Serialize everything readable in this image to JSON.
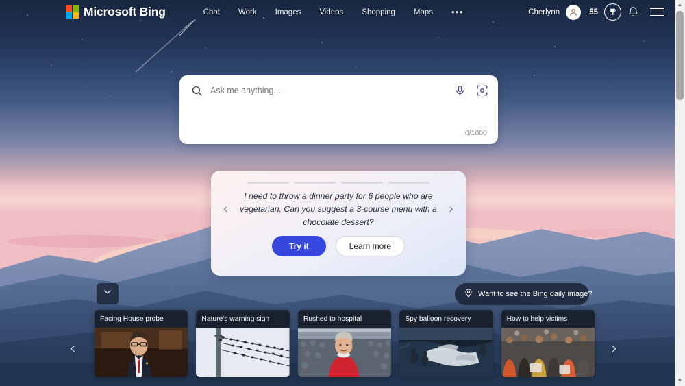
{
  "header": {
    "brand": "Microsoft Bing",
    "logo_icon": "microsoft-logo-icon",
    "logo_colors": [
      "#f25022",
      "#7fba00",
      "#00a4ef",
      "#ffb900"
    ],
    "nav": [
      {
        "label": "Chat",
        "name": "nav-chat"
      },
      {
        "label": "Work",
        "name": "nav-work"
      },
      {
        "label": "Images",
        "name": "nav-images"
      },
      {
        "label": "Videos",
        "name": "nav-videos"
      },
      {
        "label": "Shopping",
        "name": "nav-shopping"
      },
      {
        "label": "Maps",
        "name": "nav-maps"
      }
    ],
    "more_label": "•••",
    "username": "Cherlynn",
    "avatar_icon": "user-avatar-icon",
    "points": "55",
    "rewards_icon": "trophy-icon",
    "notifications_icon": "bell-icon",
    "menu_icon": "hamburger-menu-icon"
  },
  "search": {
    "placeholder": "Ask me anything...",
    "value": "",
    "search_icon": "search-icon",
    "mic_icon": "microphone-icon",
    "visual_search_icon": "visual-search-icon",
    "char_counter": "0/1000"
  },
  "suggestion": {
    "progress": [
      85,
      0,
      0,
      0
    ],
    "prompt": "I need to throw a dinner party for 6 people who are vegetarian. Can you suggest a 3-course menu with a chocolate dessert?",
    "try_label": "Try it",
    "learn_label": "Learn more",
    "prev_icon": "chevron-left-icon",
    "next_icon": "chevron-right-icon",
    "accent_color": "#3647dd"
  },
  "daily_image": {
    "label": "Want to see the Bing daily image?",
    "icon": "location-pin-icon"
  },
  "collapse": {
    "icon": "chevron-down-icon"
  },
  "news": {
    "prev_icon": "chevron-left-icon",
    "next_icon": "chevron-right-icon",
    "cards": [
      {
        "title": "Facing House probe",
        "thumb": "man-in-suit-glasses-hearing"
      },
      {
        "title": "Nature's warning sign",
        "thumb": "birds-on-power-lines"
      },
      {
        "title": "Rushed to hospital",
        "thumb": "man-red-shirt-stadium"
      },
      {
        "title": "Spy balloon recovery",
        "thumb": "sailors-recovering-debris"
      },
      {
        "title": "How to help victims",
        "thumb": "crowd-of-people-aid"
      }
    ]
  },
  "scrollbar": {
    "up_icon": "scroll-up-arrow-icon",
    "down_icon": "scroll-down-arrow-icon"
  }
}
